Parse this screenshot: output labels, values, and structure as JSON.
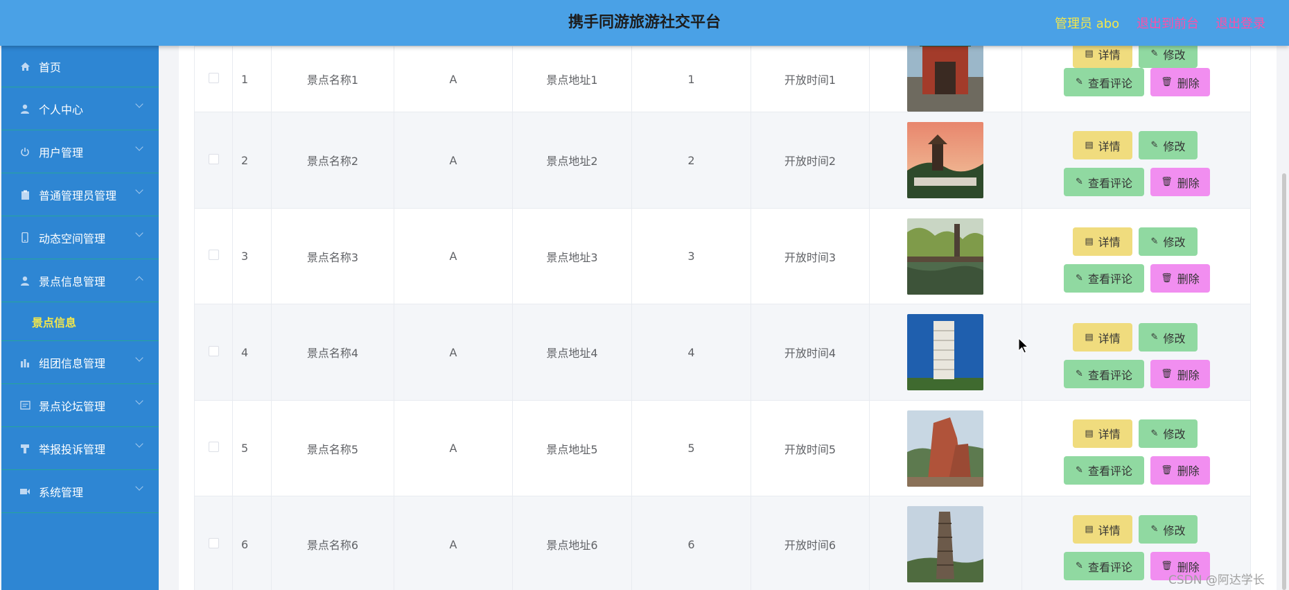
{
  "header": {
    "title": "携手同游旅游社交平台",
    "admin": "管理员 abo",
    "to_front": "退出到前台",
    "logout": "退出登录"
  },
  "sidebar": {
    "items": [
      {
        "label": "首页",
        "icon": "home-icon"
      },
      {
        "label": "个人中心",
        "icon": "user-icon"
      },
      {
        "label": "用户管理",
        "icon": "power-icon"
      },
      {
        "label": "普通管理员管理",
        "icon": "clipboard-icon"
      },
      {
        "label": "动态空间管理",
        "icon": "phone-icon"
      },
      {
        "label": "景点信息管理",
        "icon": "person-icon"
      },
      {
        "label": "组团信息管理",
        "icon": "chart-icon"
      },
      {
        "label": "景点论坛管理",
        "icon": "message-icon"
      },
      {
        "label": "举报投诉管理",
        "icon": "stamp-icon"
      },
      {
        "label": "系统管理",
        "icon": "video-icon"
      }
    ],
    "active_sub": "景点信息"
  },
  "table": {
    "rows": [
      {
        "index": "1",
        "name": "景点名称1",
        "grade": "A",
        "address": "景点地址1",
        "num": "1",
        "time": "开放时间1",
        "img": "gate"
      },
      {
        "index": "2",
        "name": "景点名称2",
        "grade": "A",
        "address": "景点地址2",
        "num": "2",
        "time": "开放时间2",
        "img": "pagoda-sunset"
      },
      {
        "index": "3",
        "name": "景点名称3",
        "grade": "A",
        "address": "景点地址3",
        "num": "3",
        "time": "开放时间3",
        "img": "lake-tower"
      },
      {
        "index": "4",
        "name": "景点名称4",
        "grade": "A",
        "address": "景点地址4",
        "num": "4",
        "time": "开放时间4",
        "img": "leaning-tower"
      },
      {
        "index": "5",
        "name": "景点名称5",
        "grade": "A",
        "address": "景点地址5",
        "num": "5",
        "time": "开放时间5",
        "img": "red-rock"
      },
      {
        "index": "6",
        "name": "景点名称6",
        "grade": "A",
        "address": "景点地址6",
        "num": "6",
        "time": "开放时间6",
        "img": "stone-pillar"
      }
    ],
    "actions": {
      "detail": "详情",
      "edit": "修改",
      "comment": "查看评论",
      "delete": "删除"
    }
  },
  "watermark": "CSDN @阿达学长"
}
